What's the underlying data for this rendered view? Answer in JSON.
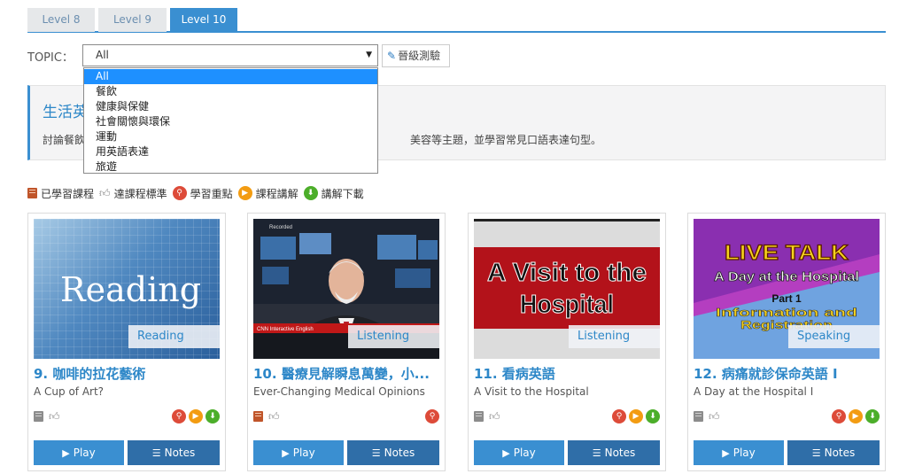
{
  "tabs": [
    {
      "label": "Level 8"
    },
    {
      "label": "Level 9"
    },
    {
      "label": "Level 10"
    }
  ],
  "topic": {
    "label": "TOPIC：",
    "selected": "All",
    "options": [
      "All",
      "餐飲",
      "健康與保健",
      "社會關懷與環保",
      "運動",
      "用英語表達",
      "旅遊"
    ],
    "test_button": "晉級測驗"
  },
  "panel": {
    "title": "生活英",
    "desc_start": "討論餐飲",
    "desc_end": "美容等主題，並學習常見口語表達句型。"
  },
  "legend": {
    "learned": "已學習課程",
    "standard": "達課程標準",
    "key_points": "學習重點",
    "lecture": "課程講解",
    "download": "講解下載"
  },
  "buttons": {
    "play": "Play",
    "notes": "Notes"
  },
  "cards": [
    {
      "title": "9. 咖啡的拉花藝術",
      "subtitle": "A Cup of Art?",
      "skill": "Reading",
      "thumb_text": "Reading",
      "book_learned": false,
      "icons": [
        "key-points",
        "lecture",
        "download"
      ]
    },
    {
      "title": "10. 醫療見解瞬息萬變，小...",
      "subtitle": "Ever-Changing Medical Opinions",
      "skill": "Listening",
      "thumb_top": "Recorded",
      "thumb_bottom": "CNN Interactive English",
      "book_learned": true,
      "icons": [
        "key-points"
      ]
    },
    {
      "title": "11. 看病英語",
      "subtitle": "A Visit to the Hospital",
      "skill": "Listening",
      "thumb_line1": "A Visit to the",
      "thumb_line2": "Hospital",
      "book_learned": false,
      "icons": [
        "key-points",
        "lecture",
        "download"
      ]
    },
    {
      "title": "12. 病痛就診保命英語 I",
      "subtitle": "A Day at the Hospital I",
      "skill": "Speaking",
      "thumb_line1": "LIVE TALK",
      "thumb_line2": "A Day at the Hospital",
      "thumb_line3": "Part 1",
      "thumb_line4": "Information and",
      "thumb_line5": "Registration",
      "book_learned": false,
      "icons": [
        "key-points",
        "lecture",
        "download"
      ]
    }
  ],
  "colors": {
    "accent": "#3a8fd1",
    "notes_button": "#2f6ea8",
    "key_points": "#dd4b39",
    "lecture": "#f39c12",
    "download": "#4cae2a"
  }
}
